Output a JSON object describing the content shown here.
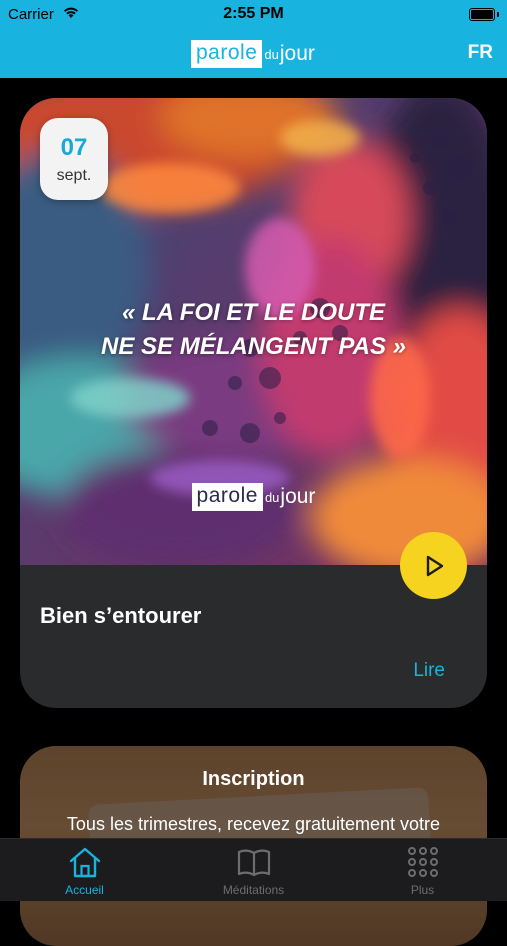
{
  "status": {
    "carrier": "Carrier",
    "time": "2:55 PM"
  },
  "header": {
    "logo": {
      "part1": "parole",
      "part2": "du",
      "part3": "jour"
    },
    "language": "FR"
  },
  "featured": {
    "date": {
      "day": "07",
      "month": "sept."
    },
    "quote_line1": "« LA FOI ET LE DOUTE",
    "quote_line2": "NE SE MÉLANGENT PAS »",
    "art_logo": {
      "part1": "parole",
      "part2": "du",
      "part3": "jour"
    },
    "title": "Bien s’entourer",
    "link": "Lire"
  },
  "signup": {
    "title": "Inscription",
    "body": "Tous les trimestres, recevez gratuitement votre"
  },
  "tabs": [
    {
      "label": "Accueil",
      "icon": "home-icon",
      "active": true
    },
    {
      "label": "Méditations",
      "icon": "book-icon",
      "active": false
    },
    {
      "label": "Plus",
      "icon": "grid-icon",
      "active": false
    }
  ],
  "colors": {
    "accent": "#18b4df",
    "play": "#f5d31e",
    "card": "#2a2b2d"
  }
}
